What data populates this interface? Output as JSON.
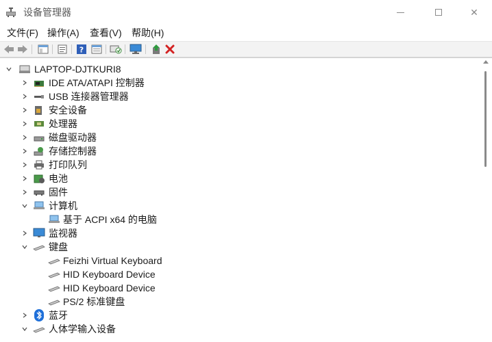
{
  "window": {
    "title": "设备管理器",
    "minimize_icon": "minimize-icon",
    "maximize_icon": "maximize-icon",
    "close_glyph": "✕"
  },
  "menu": [
    "文件(F)",
    "操作(A)",
    "查看(V)",
    "帮助(H)"
  ],
  "toolbar": {
    "buttons": [
      "back-arrow-icon",
      "forward-arrow-icon",
      "show-hide-console-tree-icon",
      "properties-icon",
      "help-icon",
      "view-icon",
      "scan-hardware-changes-icon",
      "monitor-icon",
      "update-driver-icon",
      "uninstall-device-icon"
    ]
  },
  "tree": {
    "root": "LAPTOP-DJTKURI8",
    "nodes": [
      {
        "label": "IDE ATA/ATAPI 控制器",
        "icon": "ide-controller-icon",
        "expanded": false
      },
      {
        "label": "USB 连接器管理器",
        "icon": "usb-connector-icon",
        "expanded": false
      },
      {
        "label": "安全设备",
        "icon": "security-device-icon",
        "expanded": false
      },
      {
        "label": "处理器",
        "icon": "processor-icon",
        "expanded": false
      },
      {
        "label": "磁盘驱动器",
        "icon": "disk-drive-icon",
        "expanded": false
      },
      {
        "label": "存储控制器",
        "icon": "storage-controller-icon",
        "expanded": false
      },
      {
        "label": "打印队列",
        "icon": "printer-icon",
        "expanded": false
      },
      {
        "label": "电池",
        "icon": "battery-icon",
        "expanded": false
      },
      {
        "label": "固件",
        "icon": "firmware-icon",
        "expanded": false
      },
      {
        "label": "计算机",
        "icon": "computer-icon",
        "expanded": true,
        "children": [
          "基于 ACPI x64 的电脑"
        ]
      },
      {
        "label": "监视器",
        "icon": "monitor-icon",
        "expanded": false
      },
      {
        "label": "键盘",
        "icon": "keyboard-icon",
        "expanded": true,
        "children": [
          "Feizhi Virtual Keyboard",
          "HID Keyboard Device",
          "HID Keyboard Device",
          "PS/2 标准键盘"
        ]
      },
      {
        "label": "蓝牙",
        "icon": "bluetooth-icon",
        "expanded": false
      },
      {
        "label": "人体学输入设备",
        "icon": "hid-icon",
        "expanded": true
      }
    ]
  },
  "colors": {
    "text": "#1a1a1a",
    "title_text": "#5a5a5a",
    "toolbar_bg": "#f3f3f3",
    "close_red": "#d32222",
    "bluetooth_blue": "#1e6fd9",
    "monitor_blue": "#3a8ad6"
  }
}
